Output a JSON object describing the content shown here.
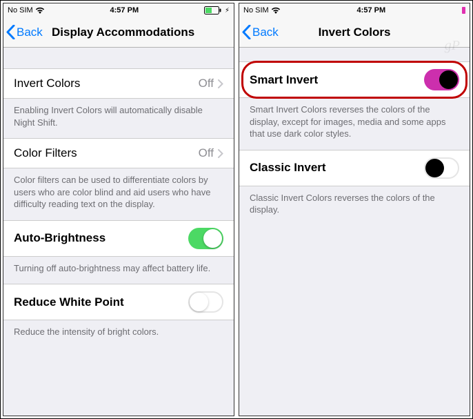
{
  "left": {
    "status": {
      "carrier": "No SIM",
      "time": "4:57 PM"
    },
    "nav": {
      "back": "Back",
      "title": "Display Accommodations"
    },
    "rows": {
      "invert": {
        "label": "Invert Colors",
        "value": "Off",
        "footer": "Enabling Invert Colors will automatically disable Night Shift."
      },
      "filters": {
        "label": "Color Filters",
        "value": "Off",
        "footer": "Color filters can be used to differentiate colors by users who are color blind and aid users who have difficulty reading text on the display."
      },
      "auto": {
        "label": "Auto-Brightness",
        "footer": "Turning off auto-brightness may affect battery life."
      },
      "rwp": {
        "label": "Reduce White Point",
        "footer": "Reduce the intensity of bright colors."
      }
    }
  },
  "right": {
    "status": {
      "carrier": "No SIM",
      "time": "4:57 PM"
    },
    "nav": {
      "back": "Back",
      "title": "Invert Colors"
    },
    "rows": {
      "smart": {
        "label": "Smart Invert",
        "footer": "Smart Invert Colors reverses the colors of the display, except for images, media and some apps that use dark color styles."
      },
      "classic": {
        "label": "Classic Invert",
        "footer": "Classic Invert Colors reverses the colors of the display."
      }
    },
    "watermark": "gP"
  }
}
